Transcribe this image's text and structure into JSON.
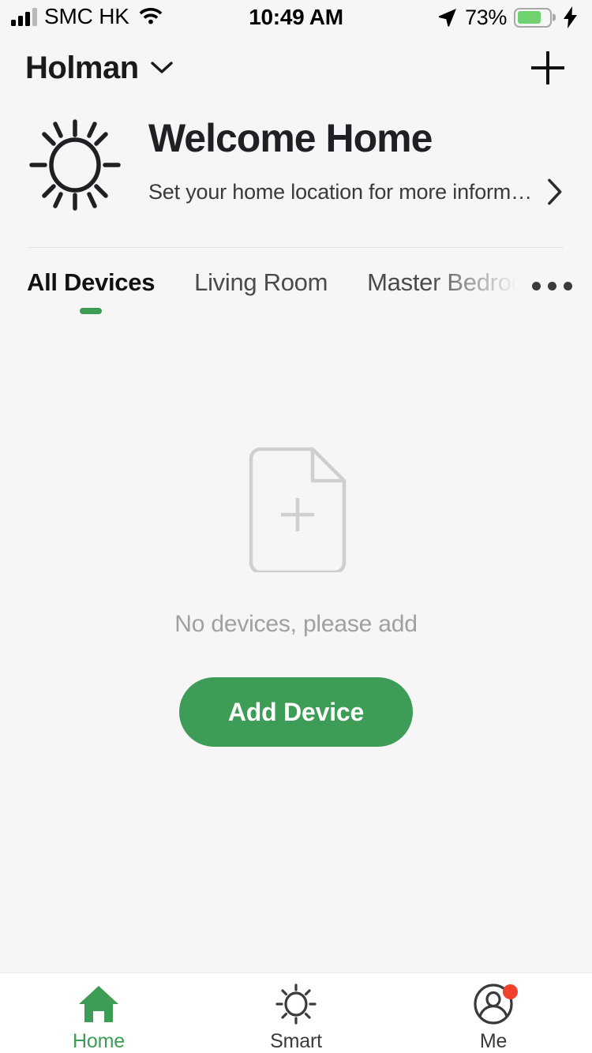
{
  "status_bar": {
    "carrier": "SMC HK",
    "time": "10:49 AM",
    "battery_percent": "73%",
    "signal_icon": "signal-bars-icon",
    "wifi_icon": "wifi-icon",
    "location_icon": "location-arrow-icon",
    "battery_icon": "battery-icon",
    "charging_icon": "lightning-bolt-icon",
    "battery_fill_level": 75,
    "battery_color": "#6fd16f"
  },
  "header": {
    "home_name": "Holman",
    "dropdown_icon": "chevron-down-icon",
    "add_icon": "plus-icon"
  },
  "welcome": {
    "icon": "sun-icon",
    "title": "Welcome Home",
    "subtitle": "Set your home location for more informa…",
    "chevron_icon": "chevron-right-icon"
  },
  "tabs": {
    "items": [
      {
        "label": "All Devices",
        "active": true
      },
      {
        "label": "Living Room",
        "active": false
      },
      {
        "label": "Master Bedroom",
        "active": false
      }
    ],
    "more_icon": "ellipsis-icon",
    "active_indicator_color": "#3d9c55"
  },
  "empty_state": {
    "icon": "document-add-icon",
    "message": "No devices, please add",
    "button_label": "Add Device",
    "button_color": "#3d9c55"
  },
  "bottom_nav": {
    "items": [
      {
        "label": "Home",
        "icon": "house-filled-icon",
        "active": true,
        "badge": false
      },
      {
        "label": "Smart",
        "icon": "sun-outline-icon",
        "active": false,
        "badge": false
      },
      {
        "label": "Me",
        "icon": "person-circle-icon",
        "active": false,
        "badge": true
      }
    ],
    "active_color": "#3d9c55",
    "badge_color": "#f0412a"
  }
}
